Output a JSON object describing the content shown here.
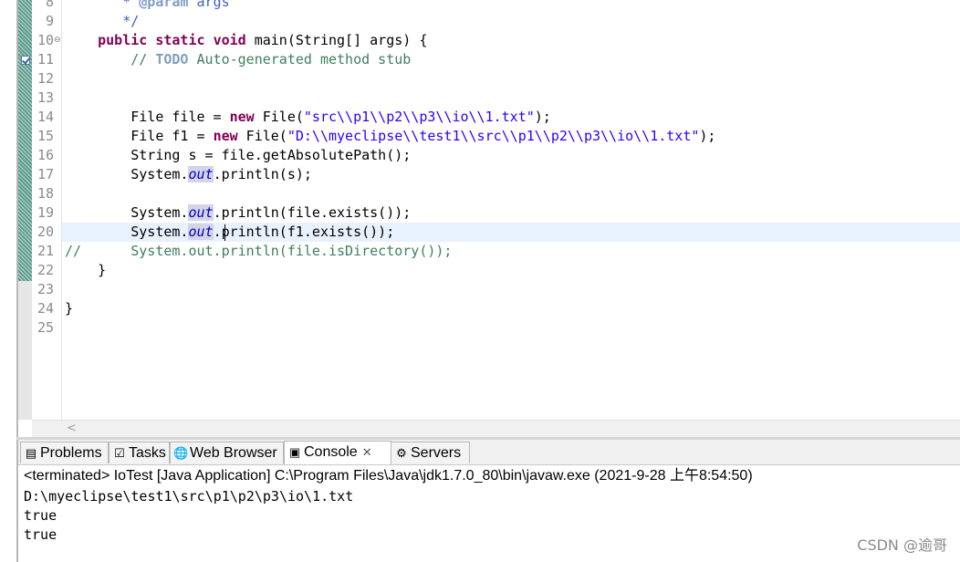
{
  "editor": {
    "line_numbers": [
      "8",
      "9",
      "10",
      "11",
      "12",
      "13",
      "14",
      "15",
      "16",
      "17",
      "18",
      "19",
      "20",
      "21",
      "22",
      "23",
      "24",
      "25"
    ],
    "code": {
      "l8_star": " * ",
      "l8_tag": "@param",
      "l8_rest": " args",
      "l9": " */",
      "l10_k1": "public",
      "l10_k2": "static",
      "l10_k3": "void",
      "l10_rest": "main(String[] args) {",
      "l11_prefix": "// ",
      "l11_todo": "TODO",
      "l11_rest": " Auto-generated method stub",
      "l14_a": "File file = ",
      "l14_new": "new",
      "l14_b": " File(",
      "l14_str": "\"src\\\\p1\\\\p2\\\\p3\\\\io\\\\1.txt\"",
      "l14_c": ");",
      "l15_a": "File f1 = ",
      "l15_new": "new",
      "l15_b": " File(",
      "l15_str": "\"D:\\\\myeclipse\\\\test1\\\\src\\\\p1\\\\p2\\\\p3\\\\io\\\\1.txt\"",
      "l15_c": ");",
      "l16": "String s = file.getAbsolutePath();",
      "sys": "System.",
      "out": "out",
      "l17_rest": ".println(s);",
      "l19_rest": ".println(file.exists());",
      "l20_rest": ".println(f1.exists());",
      "l21_prefix": "//",
      "l21_rest": "System.out.println(file.isDirectory());",
      "l22": "}",
      "l24": "}"
    }
  },
  "tabs": [
    {
      "label": "Problems",
      "icon": "problems-icon"
    },
    {
      "label": "Tasks",
      "icon": "tasks-icon"
    },
    {
      "label": "Web Browser",
      "icon": "web-browser-icon"
    },
    {
      "label": "Console",
      "icon": "console-icon",
      "active": true,
      "close": "✕"
    },
    {
      "label": "Servers",
      "icon": "servers-icon"
    }
  ],
  "console": {
    "status": "<terminated> IoTest [Java Application] C:\\Program Files\\Java\\jdk1.7.0_80\\bin\\javaw.exe (2021-9-28 上午8:54:50)",
    "output": [
      "D:\\myeclipse\\test1\\src\\p1\\p2\\p3\\io\\1.txt",
      "true",
      "true"
    ]
  },
  "watermark": "CSDN @逾哥"
}
